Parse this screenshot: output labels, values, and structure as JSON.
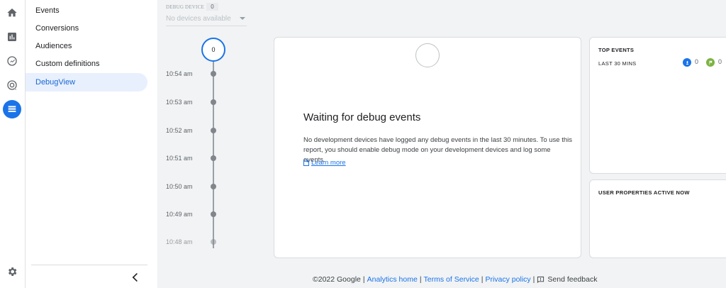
{
  "rail": {
    "icons": [
      "home-icon",
      "reports-icon",
      "explore-icon",
      "advertising-icon",
      "configure-icon",
      "admin-gear-icon"
    ]
  },
  "nav": {
    "items": [
      {
        "label": "Events"
      },
      {
        "label": "Conversions"
      },
      {
        "label": "Audiences"
      },
      {
        "label": "Custom definitions"
      },
      {
        "label": "DebugView",
        "active": true
      }
    ]
  },
  "debug_device": {
    "label": "DEBUG DEVICE",
    "count": "0",
    "placeholder": "No devices available"
  },
  "timeline": {
    "top_count": "0",
    "times": [
      "10:54 am",
      "10:53 am",
      "10:52 am",
      "10:51 am",
      "10:50 am",
      "10:49 am",
      "10:48 am"
    ]
  },
  "main": {
    "title": "Waiting for debug events",
    "description": "No development devices have logged any debug events in the last 30 minutes. To use this report, you should enable debug mode on your development devices and log some events.",
    "learn_more": "Learn more"
  },
  "top_events": {
    "title": "TOP EVENTS",
    "range": "LAST 30 MINS",
    "blue_count": "0",
    "green_count": "0"
  },
  "user_properties": {
    "title": "USER PROPERTIES ACTIVE NOW"
  },
  "footer": {
    "copyright": "©2022 Google",
    "analytics_home": "Analytics home",
    "terms": "Terms of Service",
    "privacy": "Privacy policy",
    "feedback": "Send feedback"
  },
  "colors": {
    "accent": "#1a73e8",
    "active_bg": "#e8f0fe",
    "green_badge": "#7cb342"
  }
}
